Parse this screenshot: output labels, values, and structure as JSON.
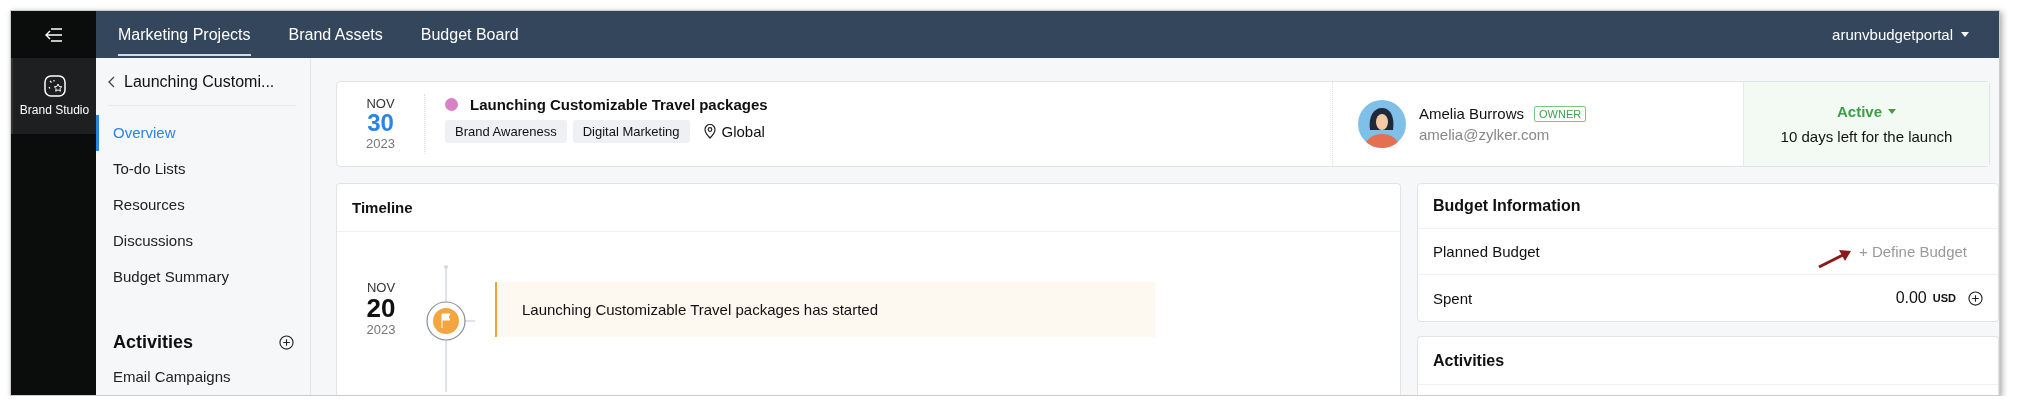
{
  "rail": {
    "apps": [
      {
        "label": "Brand Studio",
        "selected": true
      }
    ]
  },
  "top_nav": {
    "tabs": [
      {
        "label": "Marketing Projects",
        "selected": true
      },
      {
        "label": "Brand Assets",
        "selected": false
      },
      {
        "label": "Budget Board",
        "selected": false
      }
    ],
    "account": "arunvbudgetportal"
  },
  "sidebar": {
    "back_title": "Launching Customi...",
    "items": [
      {
        "label": "Overview",
        "selected": true
      },
      {
        "label": "To-do Lists",
        "selected": false
      },
      {
        "label": "Resources",
        "selected": false
      },
      {
        "label": "Discussions",
        "selected": false
      },
      {
        "label": "Budget Summary",
        "selected": false
      }
    ],
    "activities_title": "Activities",
    "activities": [
      {
        "label": "Email Campaigns",
        "selected": false
      }
    ]
  },
  "project": {
    "month": "NOV",
    "day": "30",
    "year": "2023",
    "title": "Launching Customizable Travel packages",
    "tags": [
      "Brand Awareness",
      "Digital Marketing"
    ],
    "location": "Global",
    "owner": {
      "name": "Amelia Burrows",
      "badge": "OWNER",
      "email": "amelia@zylker.com"
    },
    "status": {
      "label": "Active",
      "note": "10 days left for the launch"
    }
  },
  "timeline": {
    "title": "Timeline",
    "events": [
      {
        "month": "NOV",
        "day": "20",
        "year": "2023",
        "text": "Launching Customizable Travel packages has started"
      }
    ]
  },
  "budget": {
    "title": "Budget Information",
    "rows": [
      {
        "kind": "action",
        "label": "Planned Budget",
        "action": "+ Define Budget"
      },
      {
        "kind": "amount",
        "label": "Spent",
        "amount": "0.00",
        "currency": "USD"
      }
    ]
  },
  "activities_panel": {
    "title": "Activities"
  }
}
